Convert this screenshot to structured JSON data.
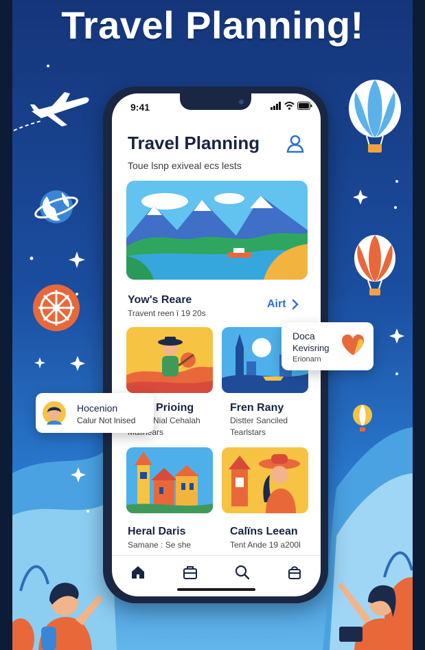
{
  "poster": {
    "headline": "Travel Planning!"
  },
  "status_bar": {
    "time": "9:41"
  },
  "app": {
    "title": "Travel Planning",
    "subtitle": "Toue lsnp exiveal ecs lests"
  },
  "section": {
    "title": "Yow's Reare",
    "subtitle": "Travent reen ï 19 20s",
    "link": "Airt"
  },
  "cards": [
    {
      "title": "Hocenion",
      "line1": "Calur Not lnised"
    },
    {
      "title": "Prioing",
      "line1": "Nial Cehalah",
      "line2": "Malinears"
    },
    {
      "title": "Fren Rany",
      "line1": "Distter Sanciled",
      "line2": "Tearlstars"
    },
    {
      "title": "Heral Daris",
      "line1": "Samane : Se she"
    },
    {
      "title": "Calïns Leean",
      "line1": "Tent Ande 19 a200l"
    }
  ],
  "popup_card": {
    "line1": "Doca",
    "line2": "Kevisring",
    "line3": "Erionarn"
  },
  "tabs": [
    {
      "icon": "home-icon"
    },
    {
      "icon": "suitcase-icon"
    },
    {
      "icon": "search-icon"
    },
    {
      "icon": "bag-icon"
    }
  ],
  "colors": {
    "accent": "#2a6fdb",
    "title": "#172442",
    "background_top": "#15357a",
    "background_bottom": "#63b6ea"
  }
}
